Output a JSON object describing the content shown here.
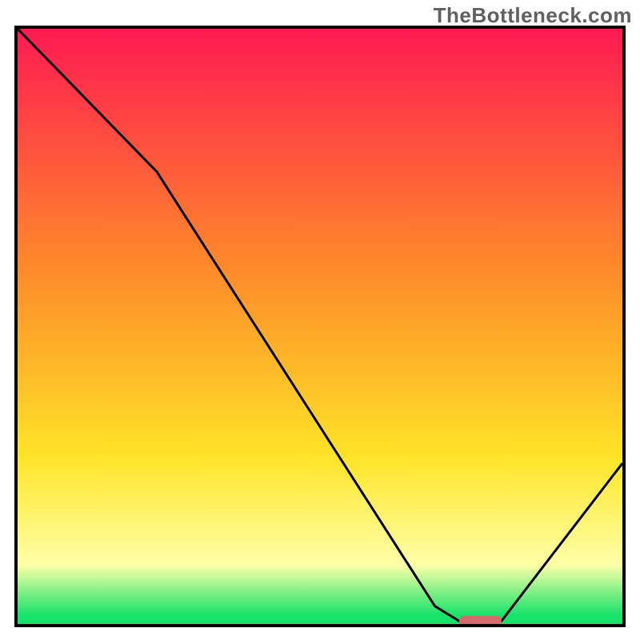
{
  "watermark": "TheBottleneck.com",
  "gradient": {
    "top": "#ff1a52",
    "mid1": "#ff8a2a",
    "mid2": "#ffe428",
    "low": "#ffffa8",
    "green": "#17e36b"
  },
  "marker": {
    "color": "#d66b6e"
  },
  "chart_data": {
    "type": "line",
    "title": "",
    "xlabel": "",
    "ylabel": "",
    "xlim": [
      0,
      100
    ],
    "ylim": [
      0,
      100
    ],
    "series": [
      {
        "name": "curve",
        "x": [
          0,
          23,
          69,
          73,
          80,
          100
        ],
        "values": [
          100,
          76,
          3,
          0.5,
          0.5,
          27
        ]
      }
    ],
    "marker_range_x": [
      73,
      80
    ],
    "marker_y": 0.5
  }
}
